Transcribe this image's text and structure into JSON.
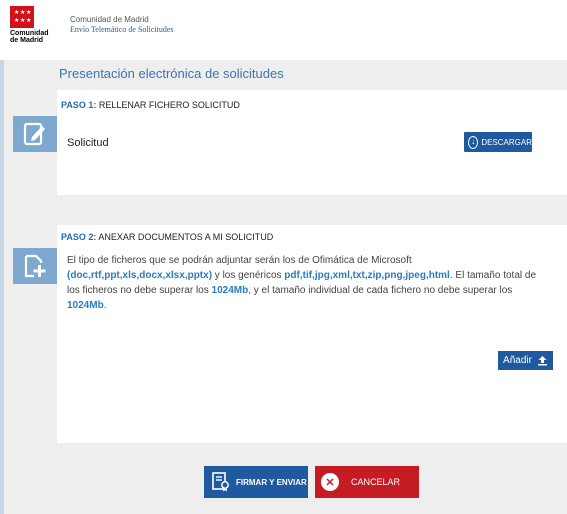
{
  "header": {
    "logo_text": "Comunidad\nde Madrid",
    "org_name": "Comunidad de Madrid",
    "service_name": "Envío Telemático de Solicitudes"
  },
  "page_title": "Presentación electrónica de solicitudes",
  "step1": {
    "number": "PASO 1:",
    "title": "RELLENAR FICHERO SOLICITUD",
    "item_label": "Solicitud",
    "download_button": "DESCARGAR"
  },
  "step2": {
    "number": "PASO 2:",
    "title": "ANEXAR DOCUMENTOS A MI SOLICITUD",
    "desc_1": "El tipo de ficheros que se podrán adjuntar serán los de Ofimática de Microsoft",
    "office_types": "(doc,rtf,ppt,xls,docx,xlsx,pptx)",
    "desc_2": " y los genéricos ",
    "generic_types": "pdf,tif,jpg,xml,txt,zip,png,jpeg,html",
    "desc_3": ". El tamaño total de los ficheros no debe superar los ",
    "total_size": "1024Mb",
    "desc_4": ", y el tamaño individual de cada fichero no debe superar los ",
    "file_size": "1024Mb",
    "desc_5": ".",
    "add_button": "Añadir"
  },
  "actions": {
    "sign_button": "FIRMAR Y ENVIAR",
    "cancel_button": "CANCELAR"
  },
  "colors": {
    "brand_red": "#d1121a",
    "primary_blue": "#1f5aa0",
    "cancel_red": "#c51b23",
    "icon_blue": "#7fa8cf"
  }
}
